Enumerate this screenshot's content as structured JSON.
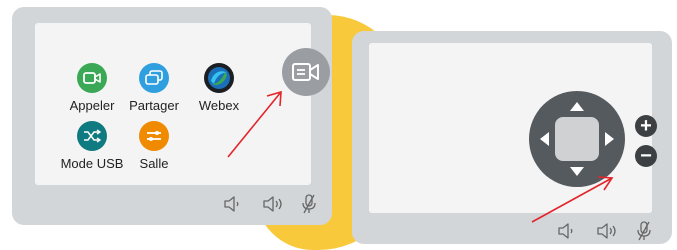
{
  "colors": {
    "accent_yellow": "#f9c93c",
    "device_frame": "#d3d6d9",
    "screen_bg": "#f4f4f4",
    "arrow_red": "#e3242b",
    "appeler": "#3aa856",
    "partager": "#2f9fe0",
    "webex": "#1b6fb8",
    "mode_usb": "#0f7a80",
    "salle": "#f08a00",
    "camera_button": "#9a9ea3",
    "dpad": "#555a5e"
  },
  "left_panel": {
    "apps": [
      {
        "label": "Appeler",
        "icon": "video-call-icon"
      },
      {
        "label": "Partager",
        "icon": "share-screen-icon"
      },
      {
        "label": "Webex",
        "icon": "webex-logo-icon"
      },
      {
        "label": "Mode USB",
        "icon": "usb-shuffle-icon"
      },
      {
        "label": "Salle",
        "icon": "room-controls-icon"
      }
    ],
    "camera_button_icon": "camera-control-icon",
    "bottom_controls": [
      "volume-down-icon",
      "volume-up-icon",
      "microphone-mute-icon"
    ]
  },
  "right_panel": {
    "dpad_arrows": [
      "up",
      "down",
      "left",
      "right"
    ],
    "zoom_in_label": "+",
    "zoom_out_label": "−",
    "bottom_controls": [
      "volume-down-icon",
      "volume-up-icon",
      "microphone-mute-icon"
    ]
  }
}
